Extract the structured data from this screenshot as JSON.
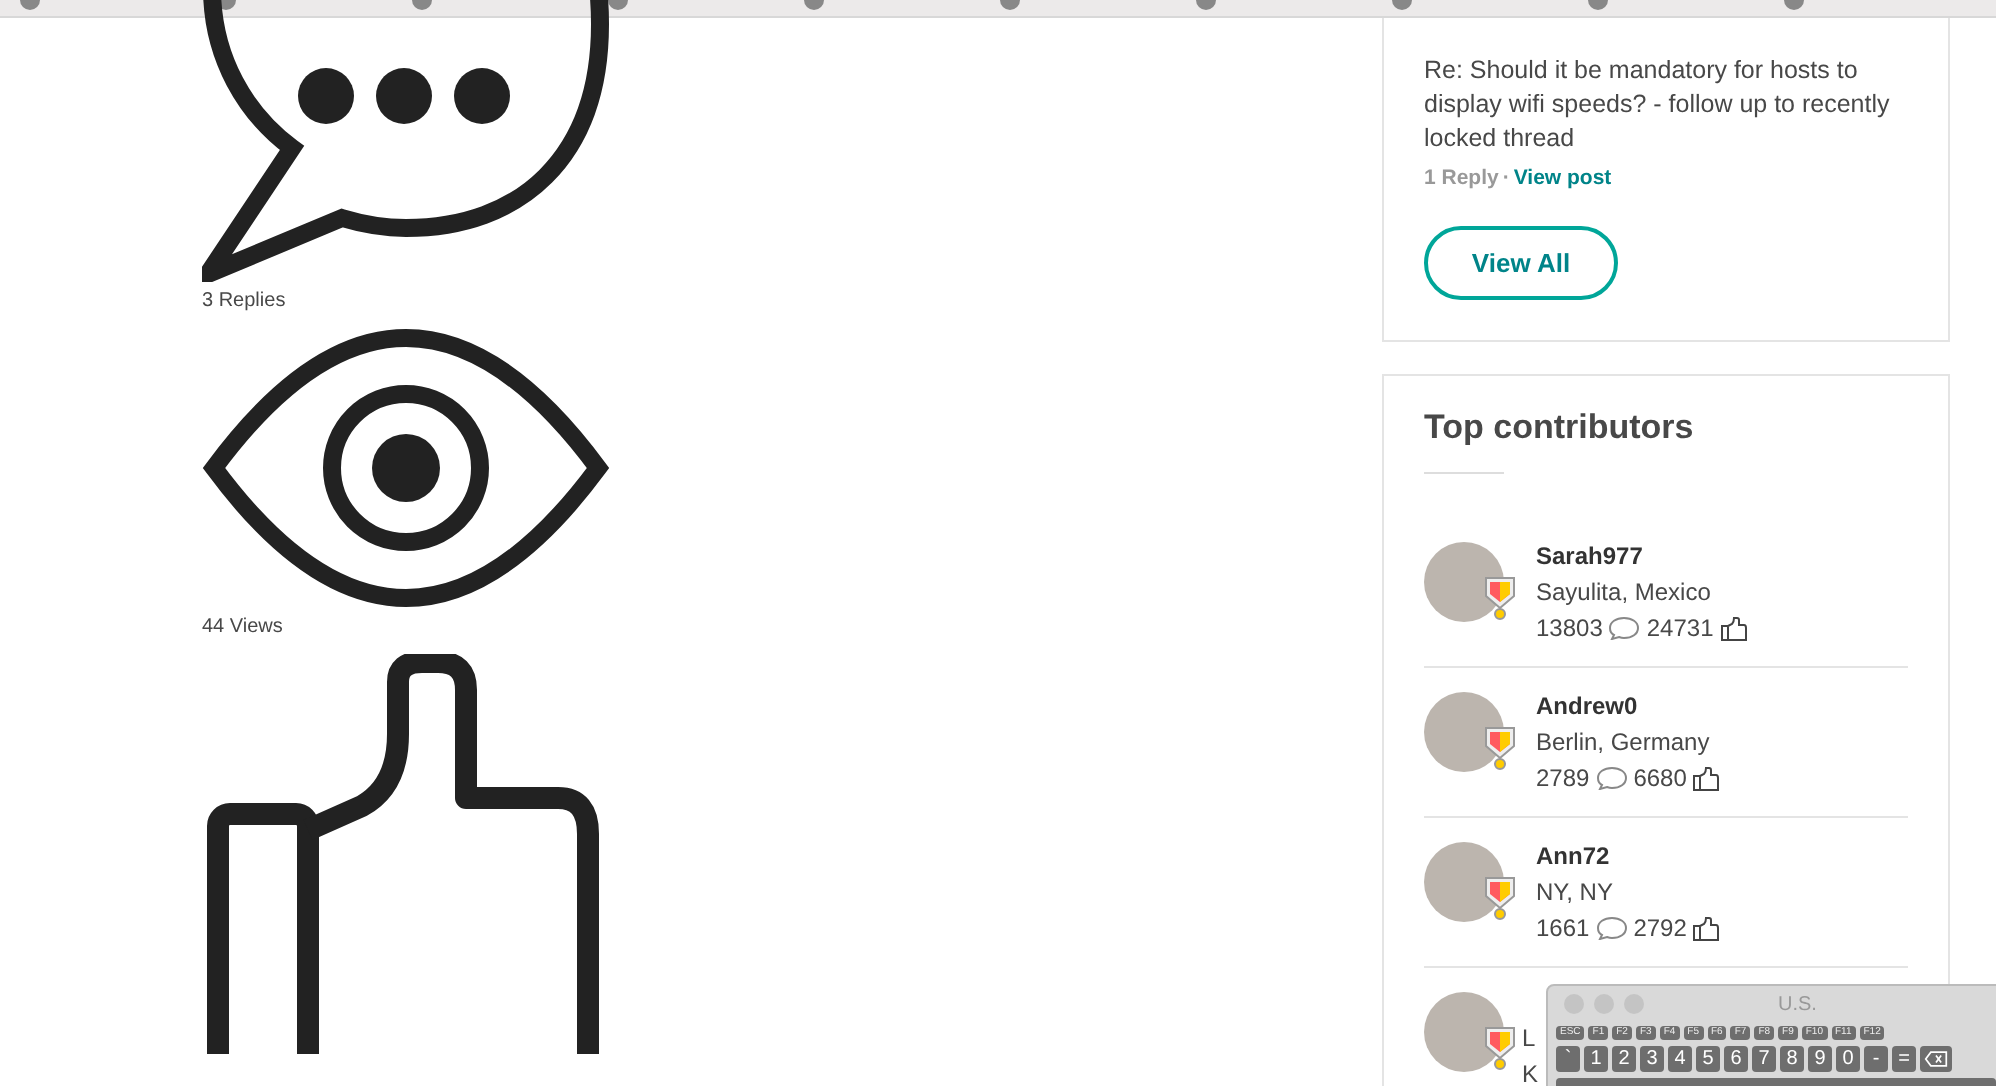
{
  "stats": [
    {
      "kind": "replies",
      "label": "3 Replies"
    },
    {
      "kind": "views",
      "label": "44 Views"
    },
    {
      "kind": "likes"
    }
  ],
  "latest_post": {
    "title": "Re: Should it be mandatory for hosts to display wifi speeds? - follow up to recently locked thread",
    "replies": "1 Reply",
    "separator": "·",
    "link": "View post",
    "button": "View All"
  },
  "top_contributors": {
    "title": "Top contributors",
    "items": [
      {
        "name": "Sarah977",
        "location": "Sayulita, Mexico",
        "posts": "13803",
        "likes": "24731"
      },
      {
        "name": "Andrew0",
        "location": "Berlin, Germany",
        "posts": "2789",
        "likes": "6680"
      },
      {
        "name": "Ann72",
        "location": "NY, NY",
        "posts": "1661",
        "likes": "2792"
      },
      {
        "location": "L",
        "line_3": "K"
      }
    ]
  },
  "keyboard_viewer": {
    "title": "U.S.",
    "function_keys": [
      "ESC",
      "F1",
      "F2",
      "F3",
      "F4",
      "F5",
      "F6",
      "F7",
      "F8",
      "F9",
      "F10",
      "F11",
      "F12"
    ],
    "number_keys": [
      "`",
      "1",
      "2",
      "3",
      "4",
      "5",
      "6",
      "7",
      "8",
      "9",
      "0",
      "-",
      "="
    ]
  }
}
